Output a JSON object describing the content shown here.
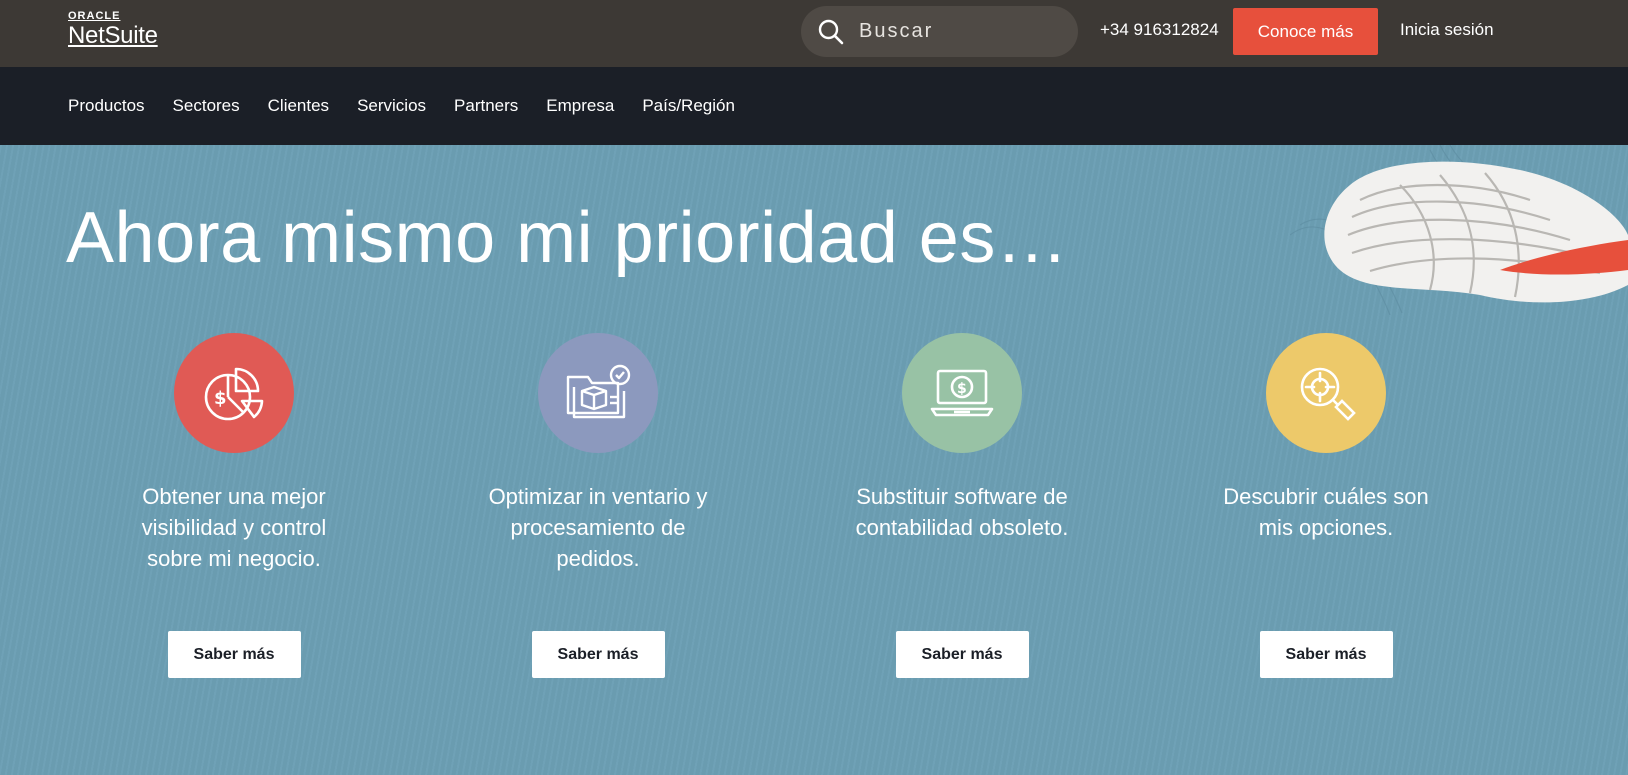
{
  "header": {
    "logo_top": "ORACLE",
    "logo_bottom": "NetSuite",
    "search_placeholder": "Buscar",
    "phone": "+34 916312824",
    "cta_label": "Conoce más",
    "login_label": "Inicia sesión"
  },
  "nav": {
    "items": [
      "Productos",
      "Sectores",
      "Clientes",
      "Servicios",
      "Partners",
      "Empresa",
      "País/Región"
    ]
  },
  "hero": {
    "title": "Ahora mismo mi prioridad es…",
    "cards": [
      {
        "icon": "pie-chart-dollar-icon",
        "color": "#e05a55",
        "text": "Obtener una mejor visibilidad y control sobre mi negocio.",
        "button": "Saber más"
      },
      {
        "icon": "inventory-folder-icon",
        "color": "#8c99be",
        "text": "Optimizar in ventario y procesamiento de pedidos.",
        "button": "Saber más"
      },
      {
        "icon": "laptop-dollar-icon",
        "color": "#98c2a5",
        "text": "Substituir software de contabilidad obsoleto.",
        "button": "Saber más"
      },
      {
        "icon": "magnifier-target-icon",
        "color": "#edc96a",
        "text": "Descubrir cuáles son mis opciones.",
        "button": "Saber más"
      }
    ]
  },
  "colors": {
    "topbar": "#3d3935",
    "nav": "#1b1f27",
    "hero": "#6c9fb4",
    "accent": "#e7503c"
  }
}
